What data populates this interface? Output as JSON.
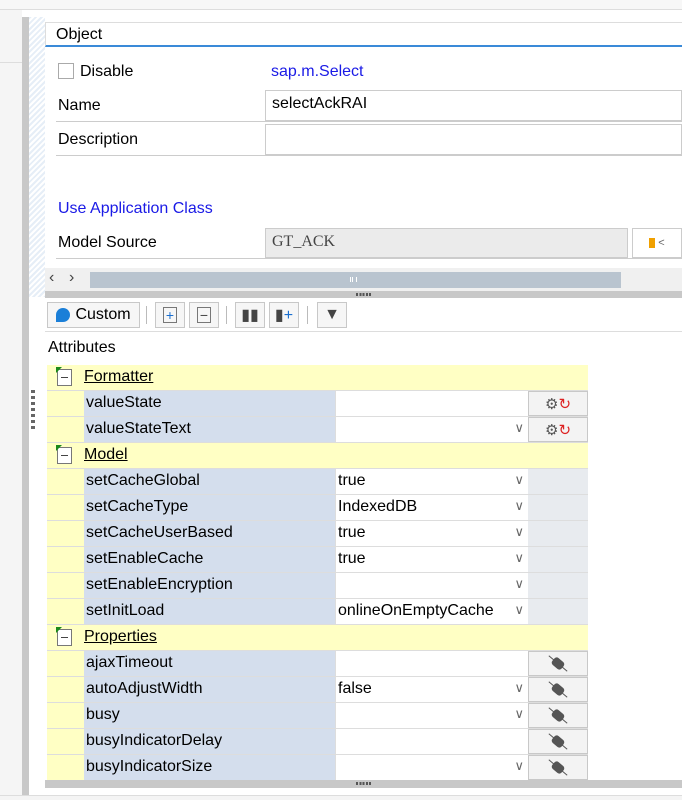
{
  "object_panel": {
    "title": "Object",
    "disable_label": "Disable",
    "disable_checked": false,
    "class_name": "sap.m.Select",
    "name_label": "Name",
    "name_value": "selectAckRAI",
    "description_label": "Description",
    "description_value": "",
    "use_app_class_label": "Use Application Class",
    "model_source_label": "Model Source",
    "model_source_value": "GT_ACK"
  },
  "toolbar": {
    "custom_label": "Custom",
    "buttons": [
      "expand-all",
      "collapse-all",
      "find",
      "find-next",
      "filter"
    ]
  },
  "attributes_label": "Attributes",
  "groups": [
    {
      "name": "Formatter",
      "action": "formatter",
      "rows": [
        {
          "name": "valueState",
          "value": "",
          "dropdown": false
        },
        {
          "name": "valueStateText",
          "value": "",
          "dropdown": true
        }
      ]
    },
    {
      "name": "Model",
      "action": "none",
      "rows": [
        {
          "name": "setCacheGlobal",
          "value": "true",
          "dropdown": true
        },
        {
          "name": "setCacheType",
          "value": "IndexedDB",
          "dropdown": true
        },
        {
          "name": "setCacheUserBased",
          "value": "true",
          "dropdown": true
        },
        {
          "name": "setEnableCache",
          "value": "true",
          "dropdown": true
        },
        {
          "name": "setEnableEncryption",
          "value": "",
          "dropdown": true
        },
        {
          "name": "setInitLoad",
          "value": "onlineOnEmptyCache",
          "dropdown": true
        }
      ]
    },
    {
      "name": "Properties",
      "action": "bind",
      "rows": [
        {
          "name": "ajaxTimeout",
          "value": "",
          "dropdown": false
        },
        {
          "name": "autoAdjustWidth",
          "value": "false",
          "dropdown": true
        },
        {
          "name": "busy",
          "value": "",
          "dropdown": true
        },
        {
          "name": "busyIndicatorDelay",
          "value": "",
          "dropdown": false
        },
        {
          "name": "busyIndicatorSize",
          "value": "",
          "dropdown": true
        }
      ]
    }
  ]
}
